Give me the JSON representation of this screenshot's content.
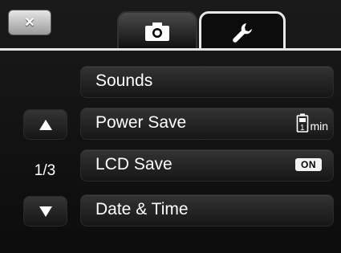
{
  "header": {
    "close_glyph": "×",
    "tabs": [
      {
        "icon": "camera-icon",
        "active": false
      },
      {
        "icon": "wrench-icon",
        "active": true
      }
    ]
  },
  "nav": {
    "page_indicator": "1/3",
    "up_icon": "triangle-up-icon",
    "down_icon": "triangle-down-icon"
  },
  "menu": {
    "items": [
      {
        "label": "Sounds"
      },
      {
        "label": "Power Save",
        "value_icon": "battery-timer-icon",
        "value_text": "min",
        "value_digit": "1"
      },
      {
        "label": "LCD Save",
        "value": "ON"
      },
      {
        "label": "Date & Time"
      }
    ]
  },
  "colors": {
    "background": "#111111",
    "text": "#ffffff",
    "active_tab_border": "#e8e8e8"
  }
}
